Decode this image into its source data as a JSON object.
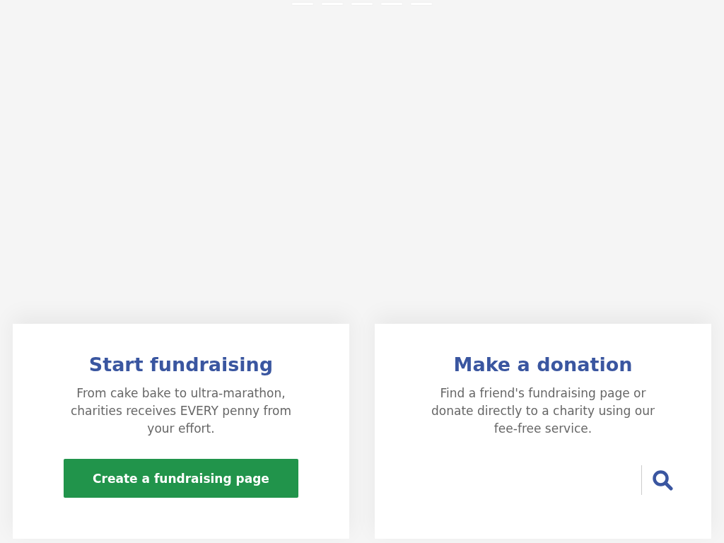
{
  "carousel": {
    "indicators": [
      {
        "selected": false
      },
      {
        "selected": false
      },
      {
        "selected": false
      },
      {
        "selected": false
      },
      {
        "selected": false
      }
    ]
  },
  "cards": [
    {
      "kind": "button",
      "title": "Start fundraising",
      "text": "From cake bake to ultra-marathon, charities receives EVERY penny from your effort.",
      "button": "Create a fundraising page"
    },
    {
      "kind": "search",
      "title": "Make a donation",
      "text": "Find a friend's fundraising page or donate directly to a charity using our fee-free service."
    }
  ]
}
